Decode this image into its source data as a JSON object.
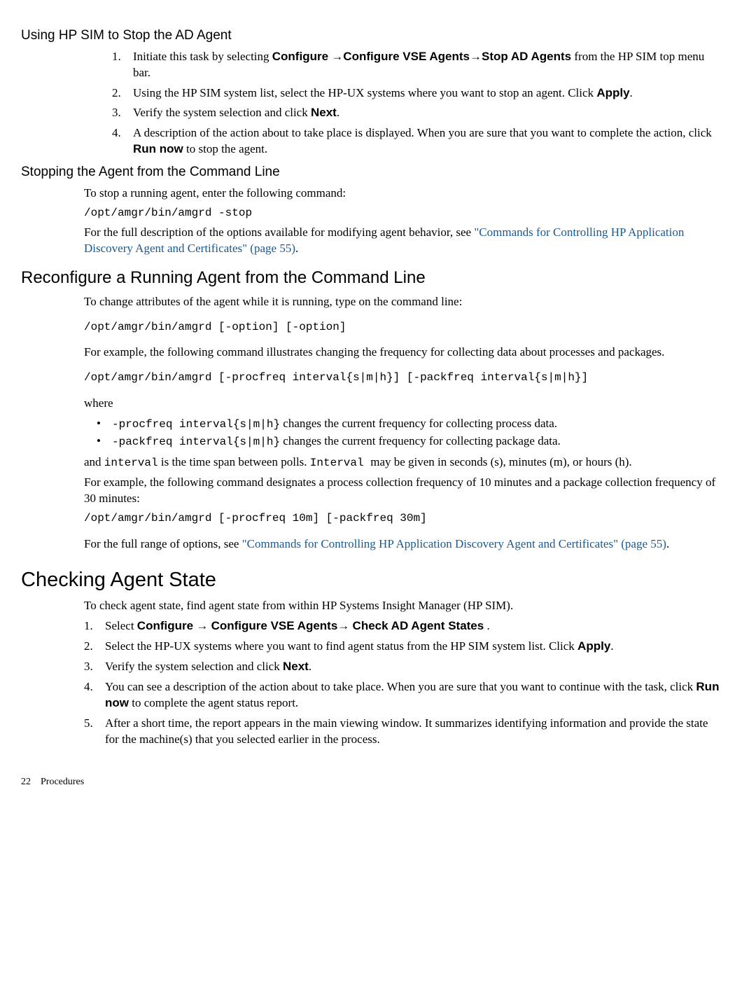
{
  "sec1": {
    "title": "Using HP SIM to Stop the AD Agent",
    "items": [
      {
        "n": "1.",
        "a": "Initiate this task by selecting ",
        "b": "Configure",
        "c": " →",
        "d": "Configure VSE Agents",
        "e": "→",
        "f": "Stop AD Agents",
        "g": "  from the HP SIM top menu bar."
      },
      {
        "n": "2.",
        "a": "Using the HP SIM system list, select the HP-UX systems where you want to stop an agent. Click ",
        "b": "Apply",
        "c": "."
      },
      {
        "n": "3.",
        "a": "Verify the system selection and click ",
        "b": "Next",
        "c": "."
      },
      {
        "n": "4.",
        "a": "A description of the action about to take place is displayed. When you are sure that you want to complete the action, click ",
        "b": "Run now",
        "c": " to stop the agent."
      }
    ]
  },
  "sec2": {
    "title": "Stopping the Agent from the Command Line",
    "p1": "To stop a running agent, enter the following command:",
    "cmd": "/opt/amgr/bin/amgrd -stop",
    "p2a": "For the full description of the options available for modifying agent behavior, see ",
    "p2link": "\"Commands for Controlling HP Application Discovery Agent and Certificates\" (page 55)",
    "p2b": "."
  },
  "sec3": {
    "title": "Reconfigure a Running Agent from the Command Line",
    "p1": "To change attributes of the agent while it is running, type on the command line:",
    "cmd1": "/opt/amgr/bin/amgrd [-option] [-option]",
    "p2": "For example, the following command illustrates changing the frequency for collecting data about processes and packages.",
    "cmd2": "/opt/amgr/bin/amgrd [-procfreq interval{s|m|h}] [-packfreq interval{s|m|h}]",
    "where": "where",
    "b1a": " -procfreq interval{s|m|h}",
    "b1b": " changes the current frequency for collecting process data.",
    "b2a": " -packfreq interval{s|m|h}",
    "b2b": " changes the current frequency for collecting package data.",
    "p3a": "and ",
    "p3m1": "interval",
    "p3b": " is the time span between polls. ",
    "p3m2": "Interval ",
    "p3c": " may be given in seconds (s), minutes (m), or hours (h).",
    "p4": "For example, the following command designates a process collection frequency of 10 minutes and a package collection frequency of 30 minutes:",
    "cmd3": "/opt/amgr/bin/amgrd [-procfreq 10m] [-packfreq 30m]",
    "p5a": "For the full range of options, see ",
    "p5link": "\"Commands for Controlling HP Application Discovery Agent and Certificates\" (page 55)",
    "p5b": "."
  },
  "sec4": {
    "title": "Checking Agent State",
    "p1": "To check agent state, find agent state from within HP Systems Insight Manager (HP SIM).",
    "items": [
      {
        "n": "1.",
        "a": "Select ",
        "b": "Configure",
        "c": " → ",
        "d": "Configure VSE Agents",
        "e": "→ ",
        "f": "Check AD Agent States",
        "g": " ."
      },
      {
        "n": "2.",
        "a": "Select the HP-UX systems where you want to find agent status from the HP SIM system list. Click ",
        "b": "Apply",
        "c": "."
      },
      {
        "n": "3.",
        "a": "Verify the system selection and click ",
        "b": "Next",
        "c": "."
      },
      {
        "n": "4.",
        "a": "You can see a description of the action about to take place. When you are sure that you want to continue with the task, click ",
        "b": "Run now",
        "c": " to complete the agent status report."
      },
      {
        "n": "5.",
        "a": "After a short time, the report appears in the main viewing window. It summarizes identifying information and provide the  state  for the machine(s) that you selected earlier in the process."
      }
    ]
  },
  "footer": {
    "page": "22",
    "label": "Procedures"
  }
}
